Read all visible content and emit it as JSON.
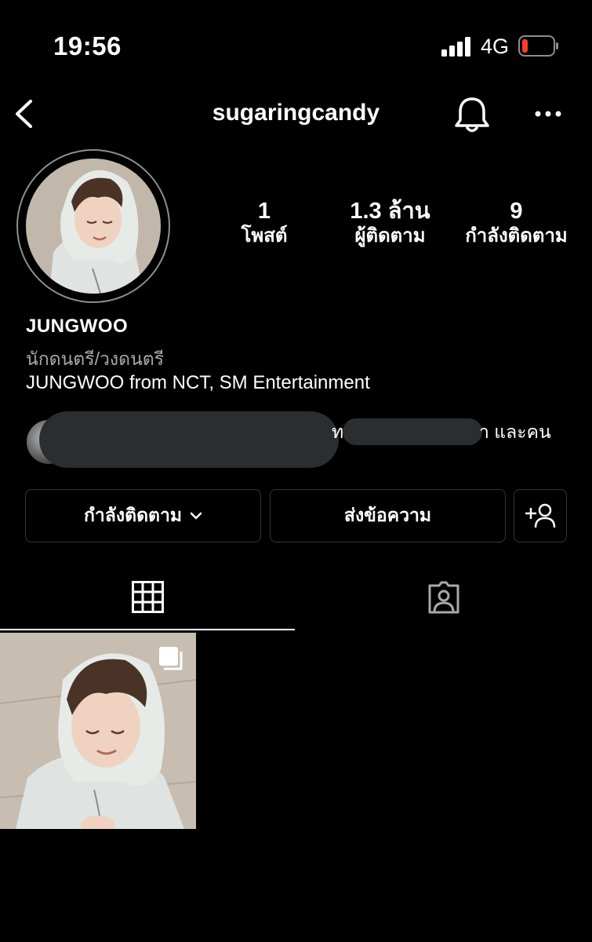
{
  "status_bar": {
    "time": "19:56",
    "network": "4G",
    "battery_level_percent": 15,
    "battery_color": "#ff3b30"
  },
  "nav": {
    "back_icon": "chevron-left-icon",
    "username": "sugaringcandy",
    "notification_icon": "bell-icon",
    "more_icon": "more-horizontal-icon"
  },
  "profile": {
    "avatar": "profile-photo",
    "stats": [
      {
        "value": "1",
        "label": "โพสต์"
      },
      {
        "value": "1.3 ล้าน",
        "label": "ผู้ติดตาม"
      },
      {
        "value": "9",
        "label": "กำลังติดตาม"
      }
    ],
    "name": "JUNGWOO",
    "category": "นักดนตรี/วงดนตรี",
    "bio": "JUNGWOO from NCT, SM Entertainment"
  },
  "followed_by": {
    "partial_char": "ท",
    "tail_text": "า และคน"
  },
  "buttons": {
    "following_label": "กำลังติดตาม",
    "message_label": "ส่งข้อความ",
    "add_user_icon": "add-user-icon"
  },
  "tabs": {
    "grid_icon": "grid-icon",
    "tagged_icon": "tagged-person-icon"
  },
  "posts": [
    {
      "type": "photo",
      "multi_icon": "carousel-icon"
    }
  ],
  "colors": {
    "background": "#000000",
    "text": "#ffffff",
    "secondary_text": "#a8a8a8",
    "button_border": "#363636",
    "redaction": "#2b2e31"
  }
}
